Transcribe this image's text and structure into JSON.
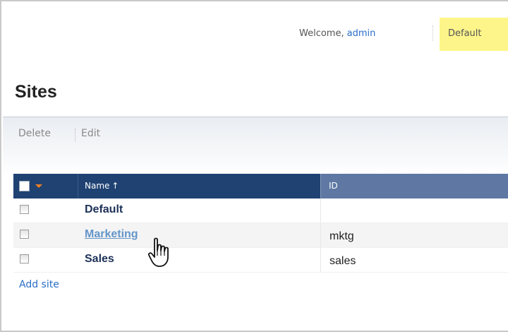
{
  "header": {
    "welcome_text": "Welcome,",
    "username": "admin",
    "current_site": "Default"
  },
  "page": {
    "title": "Sites"
  },
  "toolbar": {
    "delete_label": "Delete",
    "edit_label": "Edit"
  },
  "table": {
    "columns": [
      "Name",
      "ID"
    ],
    "sort_indicator": "↑",
    "rows": [
      {
        "name": "Default",
        "id": "",
        "is_link": false
      },
      {
        "name": "Marketing",
        "id": "mktg",
        "is_link": true
      },
      {
        "name": "Sales",
        "id": "sales",
        "is_link": false
      }
    ]
  },
  "footer": {
    "add_site_label": "Add site"
  },
  "colors": {
    "header_bg": "#1f4273",
    "id_header_bg": "#5e78a3",
    "current_site_highlight": "#fdf58a",
    "link": "#2a6ec7"
  },
  "icons": {
    "cursor": "hand-pointer-icon",
    "select_menu": "dropdown-arrow-icon"
  }
}
